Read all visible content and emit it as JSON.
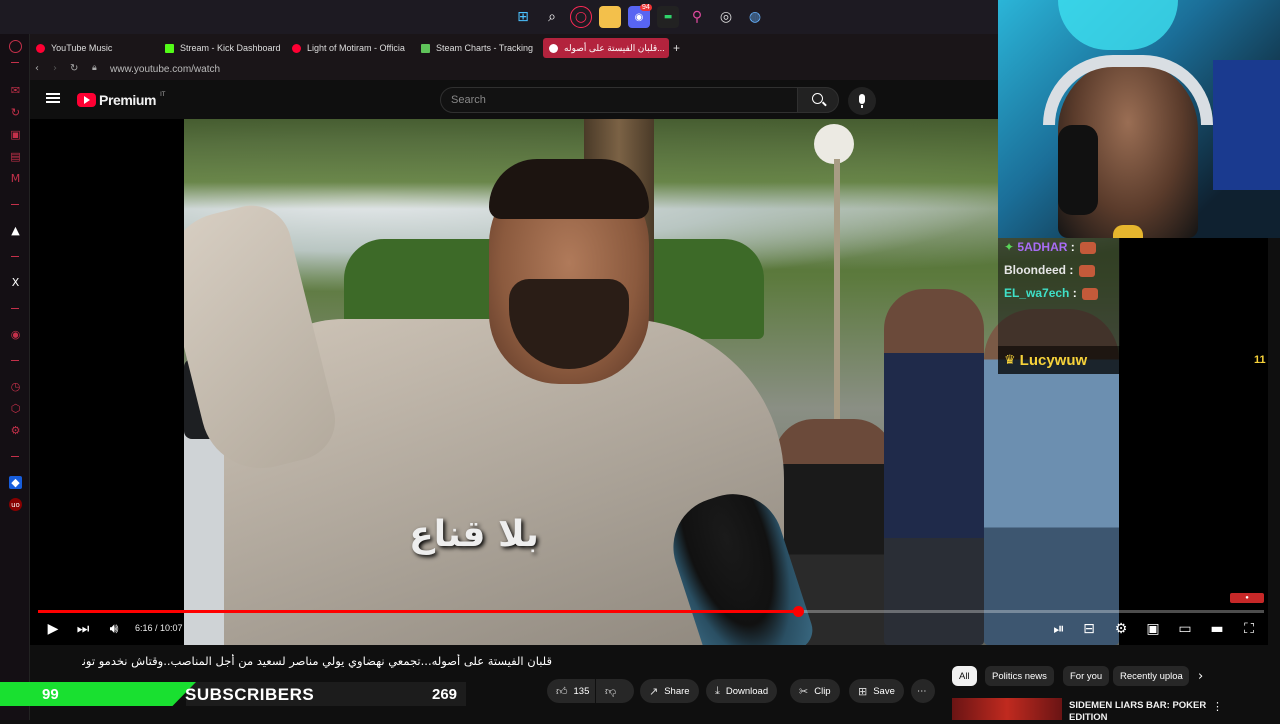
{
  "taskbar": {
    "icons": [
      "windows-start-icon",
      "search-icon",
      "opera-gx-icon",
      "file-explorer-icon",
      "discord-icon",
      "terminal-icon",
      "pin-icon",
      "chrome-icon",
      "steam-icon"
    ],
    "discord_badge": "94"
  },
  "browser": {
    "tabs": [
      {
        "label": "YouTube Music",
        "favicon_color": "#ff0033"
      },
      {
        "label": "Stream - Kick Dashboard",
        "favicon_color": "#53fc18"
      },
      {
        "label": "Light of Motiram - Officia",
        "favicon_color": "#ff0033"
      },
      {
        "label": "Steam Charts - Tracking",
        "favicon_color": "#5fc35a"
      },
      {
        "label": "قلبان الفيستة على أصوله...",
        "favicon_color": "#ff0033"
      }
    ],
    "new_tab_label": "+",
    "url": "www.youtube.com/watch"
  },
  "youtube": {
    "logo_text": "Premium",
    "logo_badge": "IT",
    "search_placeholder": "Search"
  },
  "video": {
    "caption": "بلا قناع",
    "time": "6:16 / 10:07",
    "progress": 0.62,
    "title": "قلبان الفيستة على أصوله...تجمعي نهضاوي يولي مناصر لسعيد من أجل المناصب..وقتاش نخدمو تونس🔥",
    "watermark": "●"
  },
  "stream_overlay": {
    "chat": [
      {
        "user": "5ADHAR",
        "color": "#a86cf5",
        "sep": ":"
      },
      {
        "user": "Bloondeed",
        "color": "#e6e6e6",
        "sep": ":"
      },
      {
        "user": "EL_wa7ech",
        "color": "#3fe0c8",
        "sep": ":"
      }
    ],
    "follower_name": "Lucywuw",
    "follower_count": "11"
  },
  "actions": {
    "likes": "135",
    "share": "Share",
    "download": "Download",
    "clip": "Clip",
    "save": "Save",
    "more": "⋯"
  },
  "chips": [
    "All",
    "Politics news",
    "For you",
    "Recently uploa"
  ],
  "subscriber_bar": {
    "left_count": "99",
    "label": "SUBSCRIBERS",
    "right_count": "269"
  },
  "recommendation": {
    "title": "SIDEMEN LIARS BAR: POKER EDITION"
  }
}
